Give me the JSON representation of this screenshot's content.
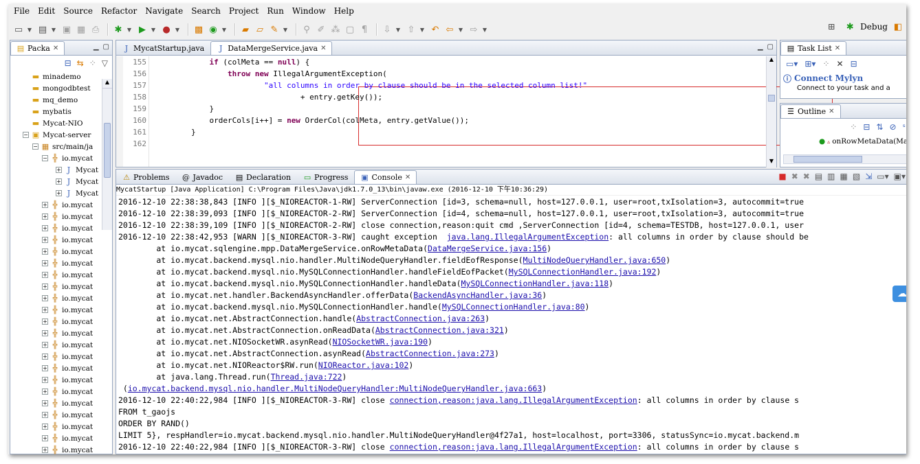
{
  "menu": [
    "File",
    "Edit",
    "Source",
    "Refactor",
    "Navigate",
    "Search",
    "Project",
    "Run",
    "Window",
    "Help"
  ],
  "perspective": {
    "debug_label": "Debug"
  },
  "package_explorer": {
    "tab": "Packa",
    "items": [
      {
        "label": "minademo",
        "level": 1,
        "kind": "folder"
      },
      {
        "label": "mongodbtest",
        "level": 1,
        "kind": "folder"
      },
      {
        "label": "mq_demo",
        "level": 1,
        "kind": "folder"
      },
      {
        "label": "mybatis",
        "level": 1,
        "kind": "folder"
      },
      {
        "label": "Mycat-NIO",
        "level": 1,
        "kind": "folder"
      },
      {
        "label": "Mycat-server",
        "level": 1,
        "kind": "project"
      },
      {
        "label": "src/main/ja",
        "level": 2,
        "kind": "srcfolder"
      },
      {
        "label": "io.mycat",
        "level": 3,
        "kind": "package"
      },
      {
        "label": "Mycat",
        "level": 4,
        "kind": "java"
      },
      {
        "label": "Mycat",
        "level": 4,
        "kind": "java"
      },
      {
        "label": "Mycat",
        "level": 4,
        "kind": "java"
      },
      {
        "label": "io.mycat",
        "level": 3,
        "kind": "package"
      },
      {
        "label": "io.mycat",
        "level": 3,
        "kind": "package"
      },
      {
        "label": "io.mycat",
        "level": 3,
        "kind": "package"
      },
      {
        "label": "io.mycat",
        "level": 3,
        "kind": "package"
      },
      {
        "label": "io.mycat",
        "level": 3,
        "kind": "package"
      },
      {
        "label": "io.mycat",
        "level": 3,
        "kind": "package"
      },
      {
        "label": "io.mycat",
        "level": 3,
        "kind": "package"
      },
      {
        "label": "io.mycat",
        "level": 3,
        "kind": "package"
      },
      {
        "label": "io.mycat",
        "level": 3,
        "kind": "package"
      },
      {
        "label": "io.mycat",
        "level": 3,
        "kind": "package"
      },
      {
        "label": "io.mycat",
        "level": 3,
        "kind": "package"
      },
      {
        "label": "io.mycat",
        "level": 3,
        "kind": "package"
      },
      {
        "label": "io.mycat",
        "level": 3,
        "kind": "package"
      },
      {
        "label": "io.mycat",
        "level": 3,
        "kind": "package"
      },
      {
        "label": "io.mycat",
        "level": 3,
        "kind": "package"
      },
      {
        "label": "io.mycat",
        "level": 3,
        "kind": "package"
      },
      {
        "label": "io.mycat",
        "level": 3,
        "kind": "package"
      },
      {
        "label": "io.mycat",
        "level": 3,
        "kind": "package"
      },
      {
        "label": "io.mycat",
        "level": 3,
        "kind": "package"
      },
      {
        "label": "io.mycat",
        "level": 3,
        "kind": "package"
      },
      {
        "label": "io.mycat",
        "level": 3,
        "kind": "package"
      },
      {
        "label": "io.mycat",
        "level": 3,
        "kind": "package"
      }
    ]
  },
  "editor": {
    "tabs": [
      {
        "label": "MycatStartup.java",
        "active": false
      },
      {
        "label": "DataMergeService.java",
        "active": true
      }
    ],
    "lines": [
      {
        "num": "155",
        "text": "            if (colMeta == null) {"
      },
      {
        "num": "156",
        "text": "                throw new IllegalArgumentException("
      },
      {
        "num": "157",
        "text": "                        \"all columns in order by clause should be in the selected column list!\""
      },
      {
        "num": "158",
        "text": "                                + entry.getKey());"
      },
      {
        "num": "159",
        "text": "            }"
      },
      {
        "num": "160",
        "text": "            orderCols[i++] = new OrderCol(colMeta, entry.getValue());"
      },
      {
        "num": "161",
        "text": "        }"
      },
      {
        "num": "162",
        "text": ""
      }
    ]
  },
  "task_list": {
    "tab": "Task List",
    "connect_title": "Connect Mylyn",
    "connect_sub": "Connect to your task and a"
  },
  "outline": {
    "tab": "Outline",
    "item": "onRowMetaData(Ma"
  },
  "console": {
    "tabs": [
      "Problems",
      "Javadoc",
      "Declaration",
      "Progress",
      "Console"
    ],
    "header": "MycatStartup [Java Application] C:\\Program Files\\Java\\jdk1.7.0_13\\bin\\javaw.exe (2016-12-10 下午10:36:29)",
    "lines": [
      [
        {
          "t": "2016-12-10 22:38:38,843 [INFO ][$_NIOREACTOR-1-RW] ServerConnection [id=3, schema=null, host=127.0.0.1, user=root,txIsolation=3, autocommit=true"
        }
      ],
      [
        {
          "t": "2016-12-10 22:38:39,093 [INFO ][$_NIOREACTOR-2-RW] ServerConnection [id=4, schema=null, host=127.0.0.1, user=root,txIsolation=3, autocommit=true"
        }
      ],
      [
        {
          "t": "2016-12-10 22:38:39,109 [INFO ][$_NIOREACTOR-2-RW] close connection,reason:quit cmd ,ServerConnection [id=4, schema=TESTDB, host=127.0.0.1, user"
        }
      ],
      [
        {
          "t": "2016-12-10 22:38:42,953 [WARN ][$_NIOREACTOR-3-RW] caught exception  "
        },
        {
          "t": "java.lang.IllegalArgumentException",
          "l": true
        },
        {
          "t": ": all columns in order by clause should be"
        }
      ],
      [
        {
          "t": "        at io.mycat.sqlengine.mpp.DataMergeService.onRowMetaData("
        },
        {
          "t": "DataMergeService.java:156",
          "l": true
        },
        {
          "t": ")"
        }
      ],
      [
        {
          "t": "        at io.mycat.backend.mysql.nio.handler.MultiNodeQueryHandler.fieldEofResponse("
        },
        {
          "t": "MultiNodeQueryHandler.java:650",
          "l": true
        },
        {
          "t": ")"
        }
      ],
      [
        {
          "t": "        at io.mycat.backend.mysql.nio.MySQLConnectionHandler.handleFieldEofPacket("
        },
        {
          "t": "MySQLConnectionHandler.java:192",
          "l": true
        },
        {
          "t": ")"
        }
      ],
      [
        {
          "t": "        at io.mycat.backend.mysql.nio.MySQLConnectionHandler.handleData("
        },
        {
          "t": "MySQLConnectionHandler.java:118",
          "l": true
        },
        {
          "t": ")"
        }
      ],
      [
        {
          "t": "        at io.mycat.net.handler.BackendAsyncHandler.offerData("
        },
        {
          "t": "BackendAsyncHandler.java:36",
          "l": true
        },
        {
          "t": ")"
        }
      ],
      [
        {
          "t": "        at io.mycat.backend.mysql.nio.MySQLConnectionHandler.handle("
        },
        {
          "t": "MySQLConnectionHandler.java:80",
          "l": true
        },
        {
          "t": ")"
        }
      ],
      [
        {
          "t": "        at io.mycat.net.AbstractConnection.handle("
        },
        {
          "t": "AbstractConnection.java:263",
          "l": true
        },
        {
          "t": ")"
        }
      ],
      [
        {
          "t": "        at io.mycat.net.AbstractConnection.onReadData("
        },
        {
          "t": "AbstractConnection.java:321",
          "l": true
        },
        {
          "t": ")"
        }
      ],
      [
        {
          "t": "        at io.mycat.net.NIOSocketWR.asynRead("
        },
        {
          "t": "NIOSocketWR.java:190",
          "l": true
        },
        {
          "t": ")"
        }
      ],
      [
        {
          "t": "        at io.mycat.net.AbstractConnection.asynRead("
        },
        {
          "t": "AbstractConnection.java:273",
          "l": true
        },
        {
          "t": ")"
        }
      ],
      [
        {
          "t": "        at io.mycat.net.NIOReactor$RW.run("
        },
        {
          "t": "NIOReactor.java:102",
          "l": true
        },
        {
          "t": ")"
        }
      ],
      [
        {
          "t": "        at java.lang.Thread.run("
        },
        {
          "t": "Thread.java:722",
          "l": true
        },
        {
          "t": ")"
        }
      ],
      [
        {
          "t": " ("
        },
        {
          "t": "io.mycat.backend.mysql.nio.handler.MultiNodeQueryHandler:MultiNodeQueryHandler.java:663",
          "l": true
        },
        {
          "t": ")"
        }
      ],
      [
        {
          "t": "2016-12-10 22:40:22,984 [INFO ][$_NIOREACTOR-3-RW] close "
        },
        {
          "t": "connection,reason:java.lang.IllegalArgumentException",
          "l": true
        },
        {
          "t": ": all columns in order by clause s"
        }
      ],
      [
        {
          "t": "FROM t_gaojs"
        }
      ],
      [
        {
          "t": "ORDER BY RAND()"
        }
      ],
      [
        {
          "t": "LIMIT 5}, respHandler=io.mycat.backend.mysql.nio.handler.MultiNodeQueryHandler@4f27a1, host=localhost, port=3306, statusSync=io.mycat.backend.m"
        }
      ],
      [
        {
          "t": "2016-12-10 22:40:22,984 [INFO ][$_NIOREACTOR-3-RW] close "
        },
        {
          "t": "connection,reason:java.lang.IllegalArgumentException",
          "l": true
        },
        {
          "t": ": all columns in order by clause s"
        }
      ]
    ]
  },
  "colors": {
    "keyword": "#7f0055",
    "string": "#2a00ff",
    "link": "#1a0dab",
    "highlight_box": "#d62b2b"
  }
}
